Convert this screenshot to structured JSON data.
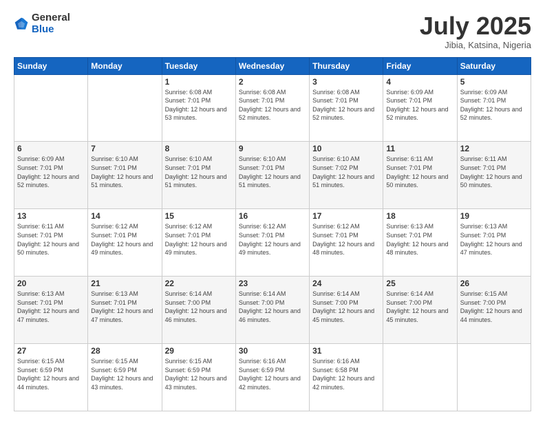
{
  "header": {
    "logo": {
      "general": "General",
      "blue": "Blue"
    },
    "title": "July 2025",
    "location": "Jibia, Katsina, Nigeria"
  },
  "calendar": {
    "weekdays": [
      "Sunday",
      "Monday",
      "Tuesday",
      "Wednesday",
      "Thursday",
      "Friday",
      "Saturday"
    ],
    "weeks": [
      [
        {
          "day": "",
          "empty": true
        },
        {
          "day": "",
          "empty": true
        },
        {
          "day": "1",
          "sunrise": "Sunrise: 6:08 AM",
          "sunset": "Sunset: 7:01 PM",
          "daylight": "Daylight: 12 hours and 53 minutes."
        },
        {
          "day": "2",
          "sunrise": "Sunrise: 6:08 AM",
          "sunset": "Sunset: 7:01 PM",
          "daylight": "Daylight: 12 hours and 52 minutes."
        },
        {
          "day": "3",
          "sunrise": "Sunrise: 6:08 AM",
          "sunset": "Sunset: 7:01 PM",
          "daylight": "Daylight: 12 hours and 52 minutes."
        },
        {
          "day": "4",
          "sunrise": "Sunrise: 6:09 AM",
          "sunset": "Sunset: 7:01 PM",
          "daylight": "Daylight: 12 hours and 52 minutes."
        },
        {
          "day": "5",
          "sunrise": "Sunrise: 6:09 AM",
          "sunset": "Sunset: 7:01 PM",
          "daylight": "Daylight: 12 hours and 52 minutes."
        }
      ],
      [
        {
          "day": "6",
          "sunrise": "Sunrise: 6:09 AM",
          "sunset": "Sunset: 7:01 PM",
          "daylight": "Daylight: 12 hours and 52 minutes."
        },
        {
          "day": "7",
          "sunrise": "Sunrise: 6:10 AM",
          "sunset": "Sunset: 7:01 PM",
          "daylight": "Daylight: 12 hours and 51 minutes."
        },
        {
          "day": "8",
          "sunrise": "Sunrise: 6:10 AM",
          "sunset": "Sunset: 7:01 PM",
          "daylight": "Daylight: 12 hours and 51 minutes."
        },
        {
          "day": "9",
          "sunrise": "Sunrise: 6:10 AM",
          "sunset": "Sunset: 7:01 PM",
          "daylight": "Daylight: 12 hours and 51 minutes."
        },
        {
          "day": "10",
          "sunrise": "Sunrise: 6:10 AM",
          "sunset": "Sunset: 7:02 PM",
          "daylight": "Daylight: 12 hours and 51 minutes."
        },
        {
          "day": "11",
          "sunrise": "Sunrise: 6:11 AM",
          "sunset": "Sunset: 7:01 PM",
          "daylight": "Daylight: 12 hours and 50 minutes."
        },
        {
          "day": "12",
          "sunrise": "Sunrise: 6:11 AM",
          "sunset": "Sunset: 7:01 PM",
          "daylight": "Daylight: 12 hours and 50 minutes."
        }
      ],
      [
        {
          "day": "13",
          "sunrise": "Sunrise: 6:11 AM",
          "sunset": "Sunset: 7:01 PM",
          "daylight": "Daylight: 12 hours and 50 minutes."
        },
        {
          "day": "14",
          "sunrise": "Sunrise: 6:12 AM",
          "sunset": "Sunset: 7:01 PM",
          "daylight": "Daylight: 12 hours and 49 minutes."
        },
        {
          "day": "15",
          "sunrise": "Sunrise: 6:12 AM",
          "sunset": "Sunset: 7:01 PM",
          "daylight": "Daylight: 12 hours and 49 minutes."
        },
        {
          "day": "16",
          "sunrise": "Sunrise: 6:12 AM",
          "sunset": "Sunset: 7:01 PM",
          "daylight": "Daylight: 12 hours and 49 minutes."
        },
        {
          "day": "17",
          "sunrise": "Sunrise: 6:12 AM",
          "sunset": "Sunset: 7:01 PM",
          "daylight": "Daylight: 12 hours and 48 minutes."
        },
        {
          "day": "18",
          "sunrise": "Sunrise: 6:13 AM",
          "sunset": "Sunset: 7:01 PM",
          "daylight": "Daylight: 12 hours and 48 minutes."
        },
        {
          "day": "19",
          "sunrise": "Sunrise: 6:13 AM",
          "sunset": "Sunset: 7:01 PM",
          "daylight": "Daylight: 12 hours and 47 minutes."
        }
      ],
      [
        {
          "day": "20",
          "sunrise": "Sunrise: 6:13 AM",
          "sunset": "Sunset: 7:01 PM",
          "daylight": "Daylight: 12 hours and 47 minutes."
        },
        {
          "day": "21",
          "sunrise": "Sunrise: 6:13 AM",
          "sunset": "Sunset: 7:01 PM",
          "daylight": "Daylight: 12 hours and 47 minutes."
        },
        {
          "day": "22",
          "sunrise": "Sunrise: 6:14 AM",
          "sunset": "Sunset: 7:00 PM",
          "daylight": "Daylight: 12 hours and 46 minutes."
        },
        {
          "day": "23",
          "sunrise": "Sunrise: 6:14 AM",
          "sunset": "Sunset: 7:00 PM",
          "daylight": "Daylight: 12 hours and 46 minutes."
        },
        {
          "day": "24",
          "sunrise": "Sunrise: 6:14 AM",
          "sunset": "Sunset: 7:00 PM",
          "daylight": "Daylight: 12 hours and 45 minutes."
        },
        {
          "day": "25",
          "sunrise": "Sunrise: 6:14 AM",
          "sunset": "Sunset: 7:00 PM",
          "daylight": "Daylight: 12 hours and 45 minutes."
        },
        {
          "day": "26",
          "sunrise": "Sunrise: 6:15 AM",
          "sunset": "Sunset: 7:00 PM",
          "daylight": "Daylight: 12 hours and 44 minutes."
        }
      ],
      [
        {
          "day": "27",
          "sunrise": "Sunrise: 6:15 AM",
          "sunset": "Sunset: 6:59 PM",
          "daylight": "Daylight: 12 hours and 44 minutes."
        },
        {
          "day": "28",
          "sunrise": "Sunrise: 6:15 AM",
          "sunset": "Sunset: 6:59 PM",
          "daylight": "Daylight: 12 hours and 43 minutes."
        },
        {
          "day": "29",
          "sunrise": "Sunrise: 6:15 AM",
          "sunset": "Sunset: 6:59 PM",
          "daylight": "Daylight: 12 hours and 43 minutes."
        },
        {
          "day": "30",
          "sunrise": "Sunrise: 6:16 AM",
          "sunset": "Sunset: 6:59 PM",
          "daylight": "Daylight: 12 hours and 42 minutes."
        },
        {
          "day": "31",
          "sunrise": "Sunrise: 6:16 AM",
          "sunset": "Sunset: 6:58 PM",
          "daylight": "Daylight: 12 hours and 42 minutes."
        },
        {
          "day": "",
          "empty": true
        },
        {
          "day": "",
          "empty": true
        }
      ]
    ]
  }
}
